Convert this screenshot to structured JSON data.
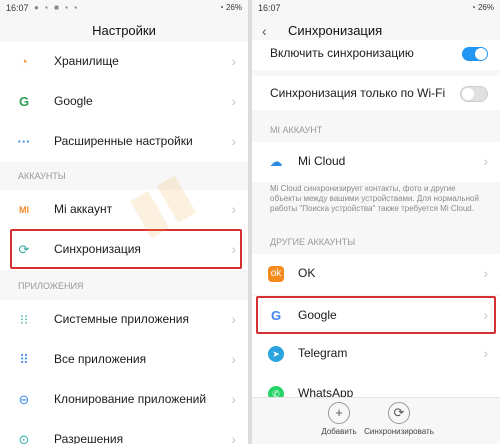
{
  "left": {
    "status": {
      "time": "16:07",
      "right": "26%"
    },
    "title": "Настройки",
    "rows": {
      "storage": "Хранилище",
      "google": "Google",
      "advanced": "Расширенные настройки",
      "mi": "Mi аккаунт",
      "sync": "Синхронизация",
      "sysapps": "Системные приложения",
      "allapps": "Все приложения",
      "clone": "Клонирование приложений",
      "perms": "Разрешения"
    },
    "sections": {
      "accounts": "АККАУНТЫ",
      "apps": "ПРИЛОЖЕНИЯ"
    },
    "icons": {
      "mi": "MI",
      "google": "G",
      "advanced": "···"
    }
  },
  "right": {
    "status": {
      "time": "16:07",
      "right": "26%"
    },
    "title": "Синхронизация",
    "rows": {
      "enable": "Включить синхронизацию",
      "wifi": "Синхронизация только по Wi-Fi",
      "micloud": "Mi Cloud",
      "ok": "OK",
      "google": "Google",
      "telegram": "Telegram",
      "whatsapp": "WhatsApp"
    },
    "sections": {
      "mi": "MI АККАУНТ",
      "other": "ДРУГИЕ АККАУНТЫ"
    },
    "desc": "Mi Cloud синхронизирует контакты, фото и другие объекты между вашими устройствами. Для нормальной работы \"Поиска устройства\" также требуется Mi Cloud.",
    "icons": {
      "google": "G"
    },
    "buttons": {
      "add": "Добавить",
      "sync": "Синхронизировать"
    }
  },
  "colors": {
    "highlight": "#d62f2f",
    "toggle_on": "#2196f3",
    "toggle_off": "#e0e0e0"
  },
  "icon_names": [
    "storage-icon",
    "google-icon",
    "more-dots-icon",
    "mi-icon",
    "sync-icon",
    "apps-grid-icon",
    "apps-circles-icon",
    "clone-icon",
    "permissions-icon",
    "cloud-icon",
    "ok-icon",
    "telegram-icon",
    "whatsapp-icon",
    "plus-icon",
    "refresh-icon"
  ]
}
